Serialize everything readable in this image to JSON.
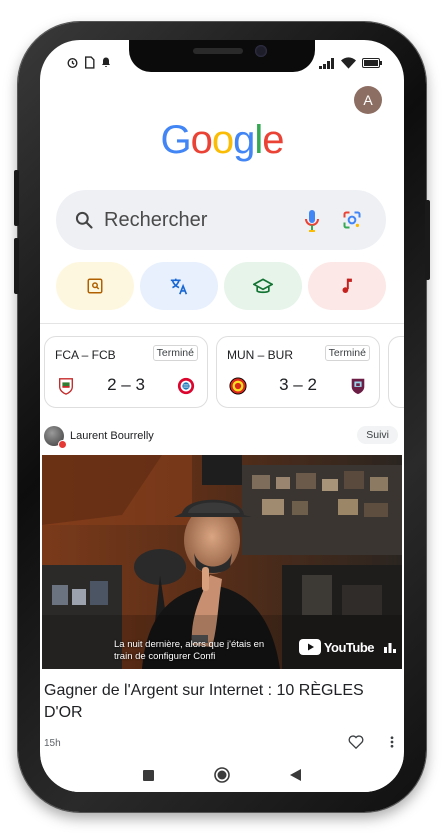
{
  "status_bar": {
    "left_icons": [
      "alarm-icon",
      "sim-icon",
      "notification-bell-icon"
    ],
    "right_icons": [
      "signal-icon",
      "wifi-icon",
      "battery-icon"
    ]
  },
  "account": {
    "avatar_letter": "A",
    "avatar_color": "#8d6e63"
  },
  "logo": {
    "letters": [
      "G",
      "o",
      "o",
      "g",
      "l",
      "e"
    ],
    "colors": [
      "#4285F4",
      "#EA4335",
      "#FBBC05",
      "#4285F4",
      "#34A853",
      "#EA4335"
    ]
  },
  "search": {
    "placeholder": "Rechercher",
    "icons": [
      "search-icon",
      "microphone-icon",
      "lens-icon"
    ]
  },
  "quick_actions": [
    {
      "name": "image-search-icon",
      "bg": "#fef7e0",
      "color": "#b06000"
    },
    {
      "name": "translate-icon",
      "bg": "#e8f0fe",
      "color": "#1967d2"
    },
    {
      "name": "education-icon",
      "bg": "#e6f4ea",
      "color": "#137333"
    },
    {
      "name": "music-note-icon",
      "bg": "#fce8e6",
      "color": "#c5221f"
    }
  ],
  "scores": [
    {
      "teams": "FCA – FCB",
      "status": "Terminé",
      "result": "2 – 3"
    },
    {
      "teams": "MUN – BUR",
      "status": "Terminé",
      "result": "3 – 2"
    }
  ],
  "feed_card": {
    "author": "Laurent Bourrelly",
    "follow_label": "Suivi",
    "caption_line1": "La nuit dernière, alors que j'étais en",
    "caption_line2": "train de configurer Confi",
    "brand": "YouTube",
    "title": "Gagner de l'Argent sur Internet : 10 RÈGLES D'OR",
    "age": "15h"
  },
  "nav": [
    "recents-square-icon",
    "home-circle-icon",
    "back-triangle-icon"
  ]
}
